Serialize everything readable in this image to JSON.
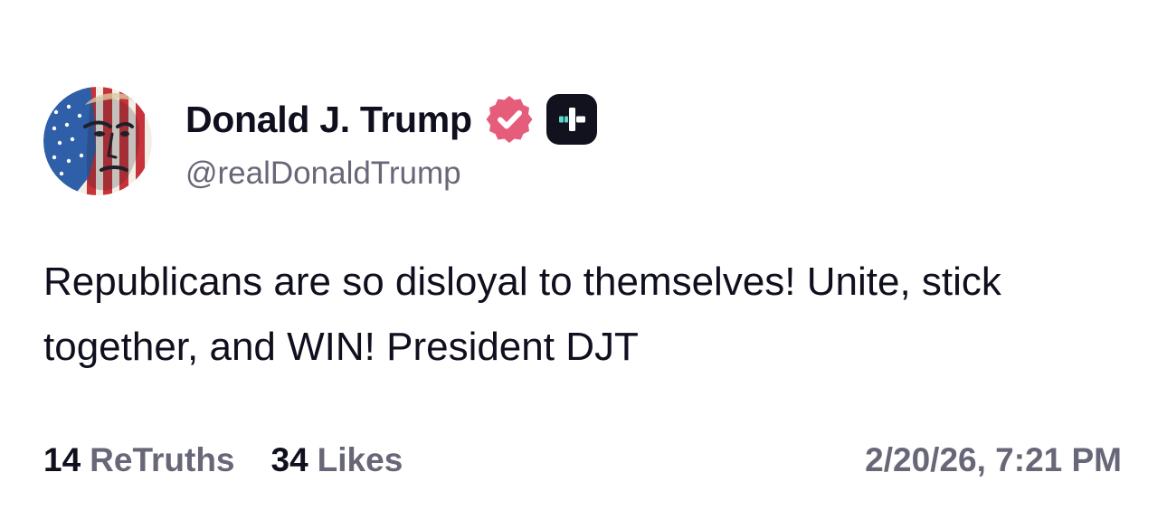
{
  "author": {
    "display_name": "Donald J. Trump",
    "handle": "@realDonaldTrump",
    "avatar_icon": "avatar-flag-portrait",
    "verified_icon": "verified-badge-icon",
    "plus_icon": "plus-badge-icon"
  },
  "post": {
    "text": "Republicans are so disloyal to themselves! Unite, stick together, and WIN! President DJT"
  },
  "stats": {
    "retruths_count": "14",
    "retruths_label": "ReTruths",
    "likes_count": "34",
    "likes_label": "Likes"
  },
  "timestamp": "2/20/26, 7:21 PM",
  "colors": {
    "text_primary": "#0f0f1e",
    "text_secondary": "#676778",
    "verified_badge": "#e65c7b",
    "plus_badge_bg": "#12121e",
    "plus_badge_accent": "#5ed8c8"
  }
}
